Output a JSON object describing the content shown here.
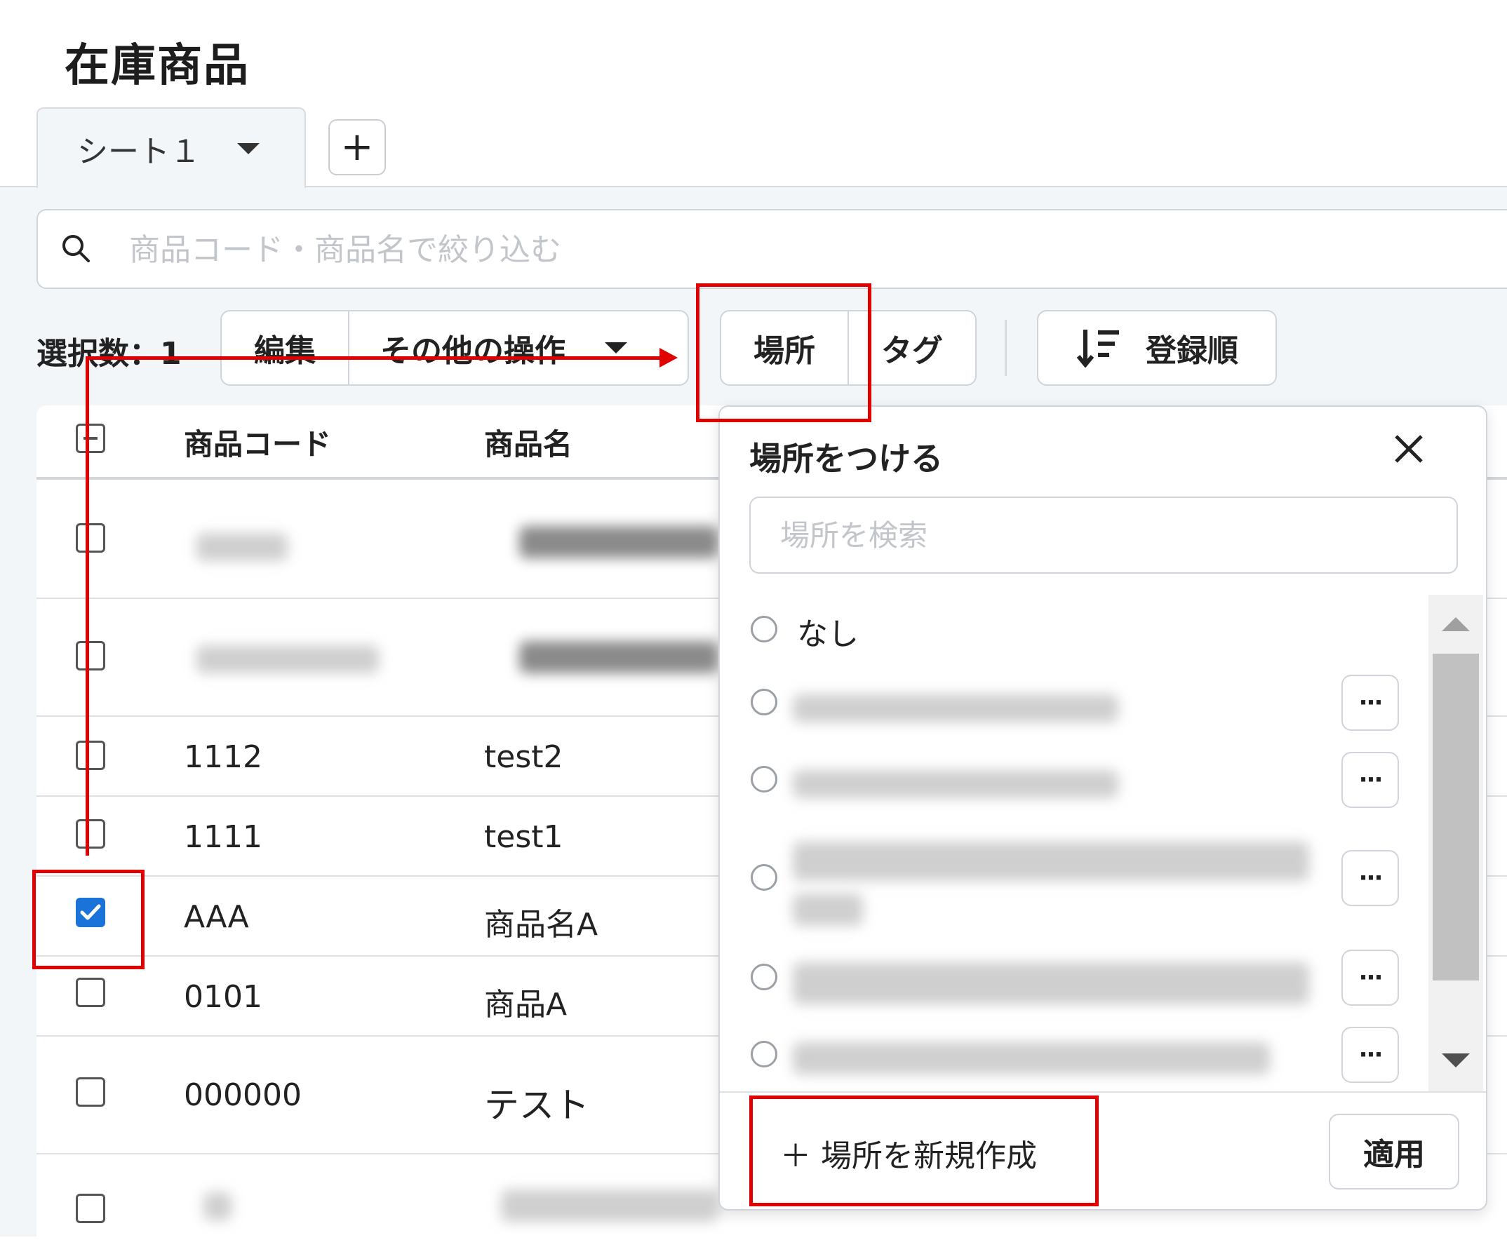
{
  "page": {
    "title": "在庫商品"
  },
  "tabs": {
    "sheet_label": "シート１",
    "add_label": "+"
  },
  "search": {
    "placeholder": "商品コード・商品名で絞り込む"
  },
  "toolbar": {
    "selection_label": "選択数：1",
    "edit_label": "編集",
    "more_actions_label": "その他の操作",
    "place_label": "場所",
    "tag_label": "タグ",
    "sort_label": "登録順"
  },
  "table": {
    "columns": [
      "商品コード",
      "商品名"
    ],
    "rows": [
      {
        "code": "",
        "name": "",
        "checked": false,
        "redacted": true
      },
      {
        "code": "",
        "name": "",
        "checked": false,
        "redacted": true
      },
      {
        "code": "1112",
        "name": "test2",
        "checked": false
      },
      {
        "code": "1111",
        "name": "test1",
        "checked": false
      },
      {
        "code": "AAA",
        "name": "商品名A",
        "checked": true
      },
      {
        "code": "0101",
        "name": "商品A",
        "checked": false
      },
      {
        "code": "000000",
        "name": "テスト",
        "checked": false
      },
      {
        "code": "",
        "name": "",
        "checked": false,
        "redacted": true
      }
    ]
  },
  "place_popover": {
    "title": "場所をつける",
    "search_placeholder": "場所を検索",
    "options": [
      {
        "label": "なし",
        "redacted": false
      },
      {
        "label": "",
        "redacted": true
      },
      {
        "label": "",
        "redacted": true
      },
      {
        "label": "",
        "redacted": true
      },
      {
        "label": "",
        "redacted": true
      },
      {
        "label": "",
        "redacted": true
      }
    ],
    "more_label": "···",
    "new_place_label": "＋ 場所を新規作成",
    "apply_label": "適用"
  },
  "colors": {
    "accent_blue": "#1a73d9",
    "annotation_red": "#e00000"
  }
}
